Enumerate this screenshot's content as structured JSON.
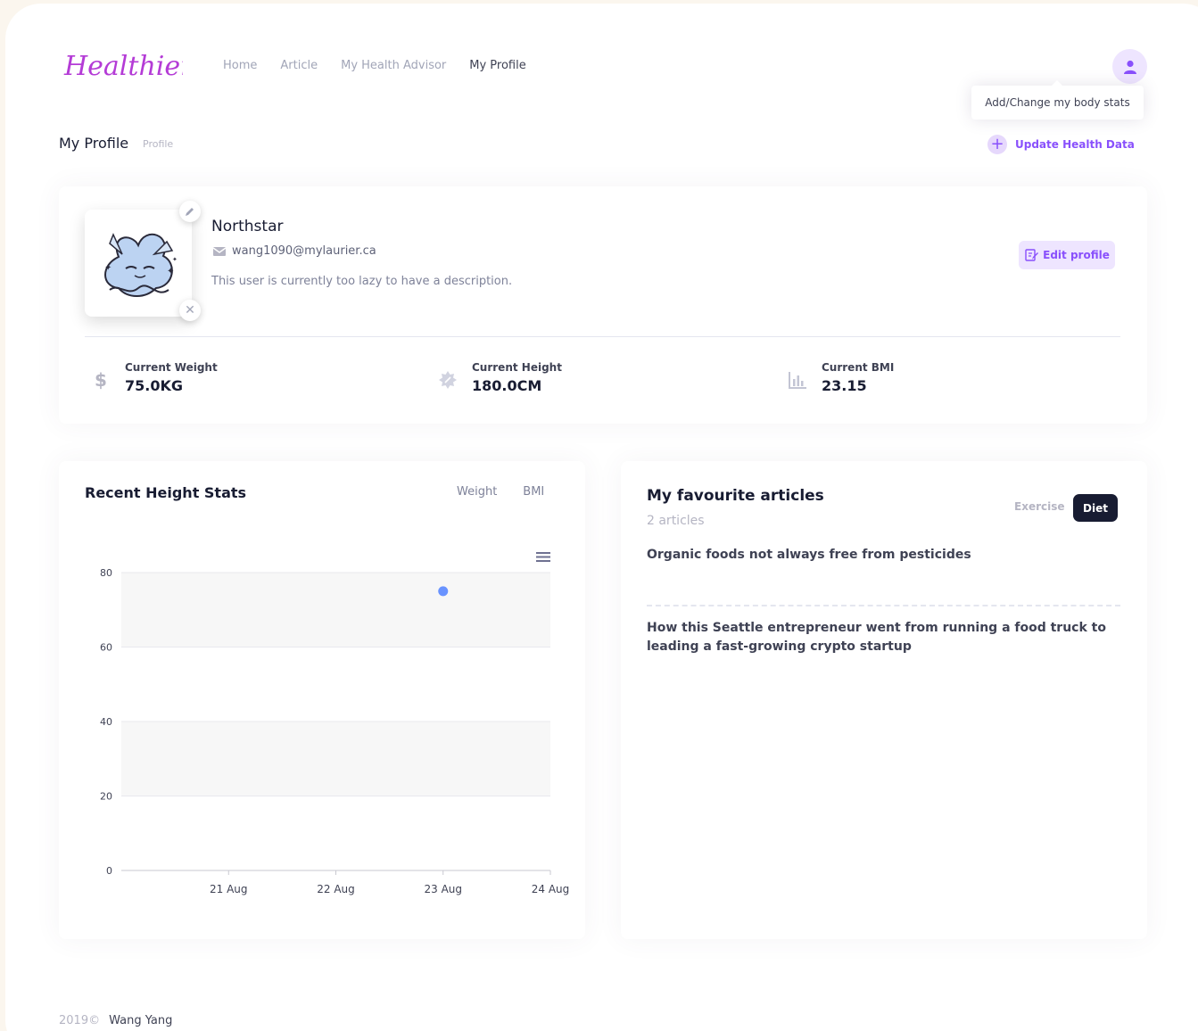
{
  "brand": {
    "logo_text": "Healthier",
    "logo_color": "#b43bd6"
  },
  "nav": {
    "items": [
      {
        "label": "Home",
        "active": false
      },
      {
        "label": "Article",
        "active": false
      },
      {
        "label": "My Health Advisor",
        "active": false
      },
      {
        "label": "My Profile",
        "active": true
      }
    ]
  },
  "header": {
    "user_icon": "user-icon",
    "tooltip": "Add/Change my body stats"
  },
  "subheader": {
    "title": "My Profile",
    "breadcrumb": "Profile",
    "update_label": "Update Health Data",
    "update_icon": "plus-icon"
  },
  "profile": {
    "name": "Northstar",
    "email": "wang1090@mylaurier.ca",
    "description": "This user is currently too lazy to have a description.",
    "edit_label": "Edit profile",
    "stats": [
      {
        "label": "Current Weight",
        "value": "75.0KG",
        "icon": "dollar-icon"
      },
      {
        "label": "Current Height",
        "value": "180.0CM",
        "icon": "badge-icon"
      },
      {
        "label": "Current BMI",
        "value": "23.15",
        "icon": "bar-chart-icon"
      }
    ]
  },
  "chart_card": {
    "title": "Recent Height Stats",
    "tabs": [
      "Weight",
      "BMI"
    ],
    "menu_icon": "hamburger-menu-icon"
  },
  "chart_data": {
    "type": "scatter",
    "title": "Recent Height Stats",
    "xlabel": "",
    "ylabel": "",
    "x_ticks": [
      "21 Aug",
      "22 Aug",
      "23 Aug",
      "24 Aug"
    ],
    "y_ticks": [
      0,
      20,
      40,
      60,
      80
    ],
    "ylim": [
      0,
      80
    ],
    "grid": true,
    "series": [
      {
        "color": "#6993ff",
        "points": [
          {
            "x": "23 Aug",
            "y": 75
          }
        ]
      }
    ]
  },
  "articles": {
    "title": "My favourite articles",
    "count": "2 articles",
    "tabs": [
      {
        "label": "Exercise",
        "active": false
      },
      {
        "label": "Diet",
        "active": true
      }
    ],
    "items": [
      "Organic foods not always free from pesticides",
      "How this Seattle entrepreneur went from running a food truck to leading a fast-growing crypto startup"
    ]
  },
  "footer": {
    "year": "2019©",
    "author": "Wang Yang"
  }
}
